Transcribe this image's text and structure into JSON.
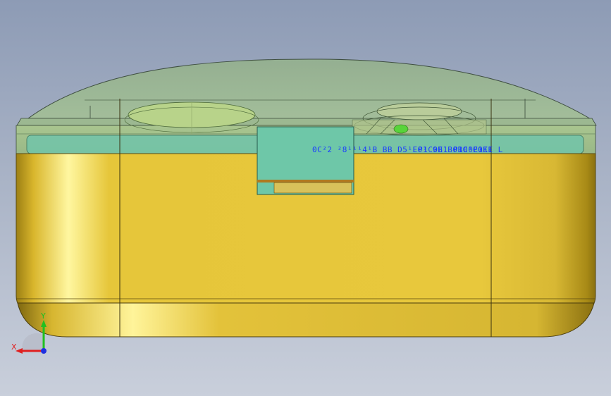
{
  "viewport": {
    "background_top": "#8d9bb5",
    "background_bottom": "#c9cfdb"
  },
  "model": {
    "body_color": "#e6c63a",
    "cover_color": "#8fb79a",
    "accent_color": "#6cc7a8"
  },
  "annotation": {
    "overlapped_text": [
      "0C²2 ²8¹¹¹4¹B BB D5¹E0¹ 9B B0B0¹C0E1",
      "P1C0E1 P1C0E1",
      "P0KE L"
    ]
  },
  "triad": {
    "x_label": "X",
    "y_label": "Y",
    "x_color": "#e02020",
    "y_color": "#20c020",
    "z_color": "#2030e0"
  }
}
